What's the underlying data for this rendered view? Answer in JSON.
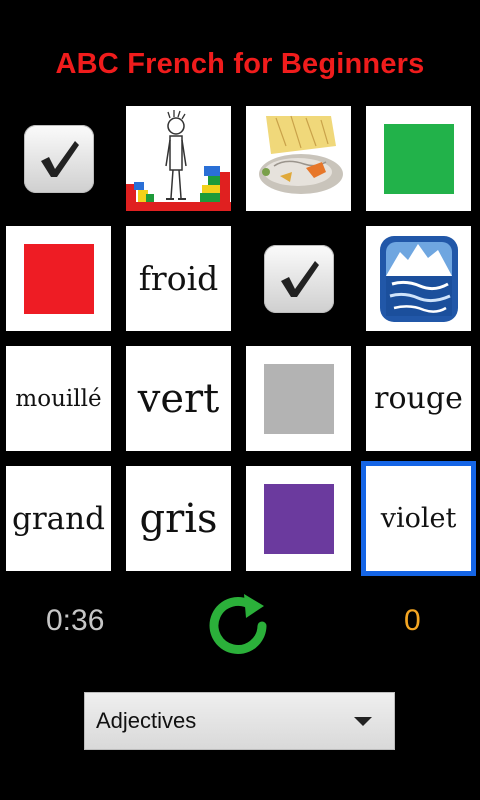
{
  "app": {
    "title": "ABC French for Beginners"
  },
  "tiles": [
    {
      "kind": "check",
      "label": ""
    },
    {
      "kind": "picture",
      "icon": "stick-figure-with-blocks-icon",
      "label": ""
    },
    {
      "kind": "picture",
      "icon": "wet-puddle-icon",
      "label": ""
    },
    {
      "kind": "color",
      "color": "#22b24a",
      "label": ""
    },
    {
      "kind": "color",
      "color": "#ee1c24",
      "label": ""
    },
    {
      "kind": "word",
      "label": "froid"
    },
    {
      "kind": "check",
      "label": ""
    },
    {
      "kind": "picture",
      "icon": "iceberg-icon",
      "label": ""
    },
    {
      "kind": "word",
      "label": "mouillé"
    },
    {
      "kind": "word",
      "label": "vert"
    },
    {
      "kind": "color",
      "color": "#b3b3b3",
      "label": ""
    },
    {
      "kind": "word",
      "label": "rouge"
    },
    {
      "kind": "word",
      "label": "grand"
    },
    {
      "kind": "word",
      "label": "gris"
    },
    {
      "kind": "color",
      "color": "#6b3a9e",
      "label": ""
    },
    {
      "kind": "word",
      "label": "violet",
      "selected": true
    }
  ],
  "status": {
    "timer": "0:36",
    "score": "0"
  },
  "category_select": {
    "selected": "Adjectives"
  },
  "colors": {
    "title": "#f01c1c",
    "selection": "#1565e6",
    "score": "#f4a623",
    "refresh": "#2bb03a"
  }
}
